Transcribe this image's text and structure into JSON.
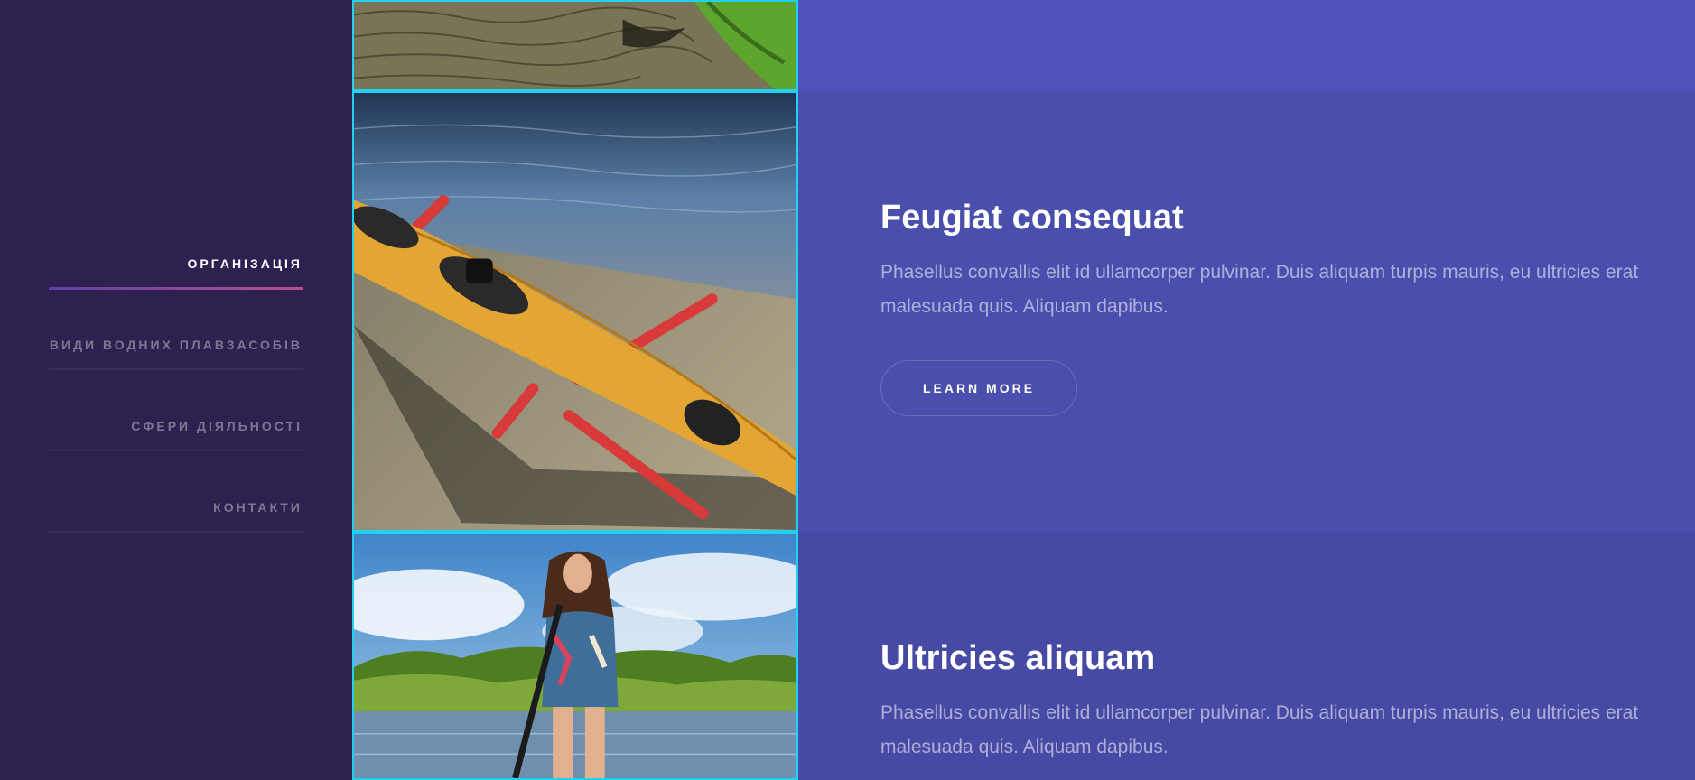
{
  "nav": {
    "items": [
      {
        "label": "ОРГАНІЗАЦІЯ",
        "active": true
      },
      {
        "label": "ВИДИ ВОДНИХ ПЛАВЗАСОБІВ"
      },
      {
        "label": "СФЕРИ ДІЯЛЬНОСТІ"
      },
      {
        "label": "КОНТАКТИ"
      }
    ]
  },
  "spotlights": [
    {
      "image": "kayak-water-photo"
    },
    {
      "image": "yellow-kayak-on-beach-photo",
      "heading": "Feugiat consequat",
      "text": "Phasellus convallis elit id ullamcorper pulvinar. Duis aliquam turpis mauris, eu ultricies erat malesuada quis. Aliquam dapibus.",
      "button": "LEARN MORE"
    },
    {
      "image": "woman-paddleboard-photo",
      "heading": "Ultricies aliquam",
      "text": "Phasellus convallis elit id ullamcorper pulvinar. Duis aliquam turpis mauris, eu ultricies erat malesuada quis. Aliquam dapibus."
    }
  ],
  "colors": {
    "sidebar": "#2e2150",
    "accent_border": "#21d2f0",
    "section_1": "#4f52b6",
    "section_2": "#4a4fad",
    "section_3": "#474aa4"
  }
}
